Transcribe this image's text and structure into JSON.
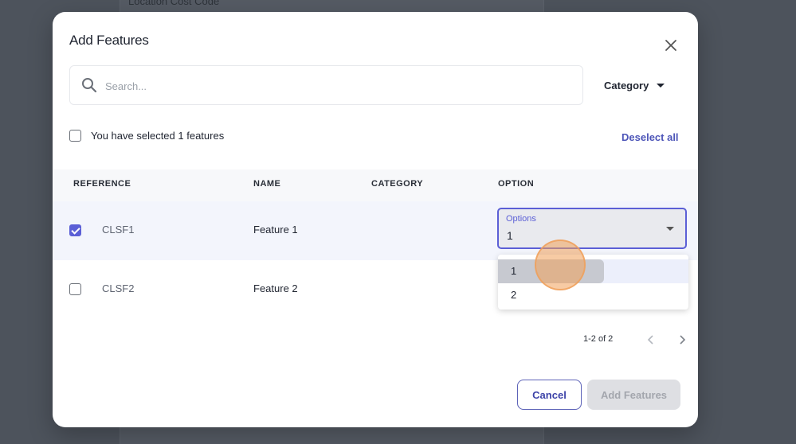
{
  "background": {
    "label": "Location Cost Code"
  },
  "modal": {
    "title": "Add Features",
    "search": {
      "placeholder": "Search...",
      "value": ""
    },
    "category_filter": "Category",
    "selection_text": "You have selected 1 features",
    "deselect_all": "Deselect all",
    "table": {
      "headers": [
        "REFERENCE",
        "NAME",
        "CATEGORY",
        "OPTION"
      ],
      "rows": [
        {
          "reference": "CLSF1",
          "name": "Feature 1",
          "category": "",
          "checked": true
        },
        {
          "reference": "CLSF2",
          "name": "Feature 2",
          "category": "",
          "checked": false
        }
      ]
    },
    "option_select": {
      "label": "Options",
      "value": "1",
      "options": [
        "1",
        "2"
      ]
    },
    "pagination": "1-2 of 2",
    "buttons": {
      "cancel": "Cancel",
      "add": "Add Features"
    }
  },
  "colors": {
    "accent": "#5b5fd6",
    "link": "#4d55b8",
    "overlay": "#4d535c"
  },
  "icons": {
    "search": "search-icon",
    "close": "close-icon",
    "prev": "chevron-left-icon",
    "next": "chevron-right-icon"
  }
}
